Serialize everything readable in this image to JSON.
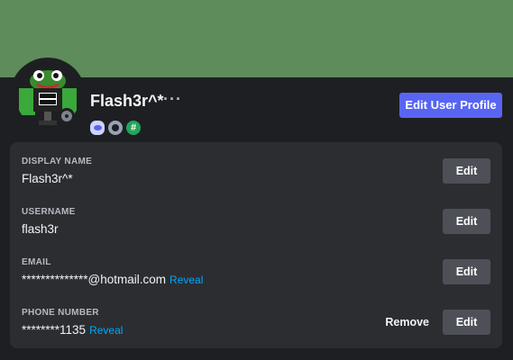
{
  "profile": {
    "username_display": "Flash3r^*",
    "more_label": "···",
    "edit_profile_label": "Edit User Profile",
    "status": "offline",
    "badges": [
      {
        "icon": "hypesquad-badge-icon"
      },
      {
        "icon": "nitro-badge-icon"
      },
      {
        "icon": "hashtag-badge-icon",
        "glyph": "#"
      }
    ],
    "avatar_label": "PARENTAL ADVISORY EXPLICIT CONTENT"
  },
  "fields": {
    "display_name": {
      "label": "DISPLAY NAME",
      "value": "Flash3r^*",
      "edit": "Edit"
    },
    "username": {
      "label": "USERNAME",
      "value": "flash3r",
      "edit": "Edit"
    },
    "email": {
      "label": "EMAIL",
      "value": "**************@hotmail.com",
      "reveal": "Reveal",
      "edit": "Edit"
    },
    "phone": {
      "label": "PHONE NUMBER",
      "value": "********1135",
      "reveal": "Reveal",
      "remove": "Remove",
      "edit": "Edit"
    }
  },
  "colors": {
    "banner": "#5e8c5a",
    "accent": "#5865f2",
    "link": "#00a8fc",
    "card": "#2b2d31",
    "background": "#1e1f22"
  }
}
